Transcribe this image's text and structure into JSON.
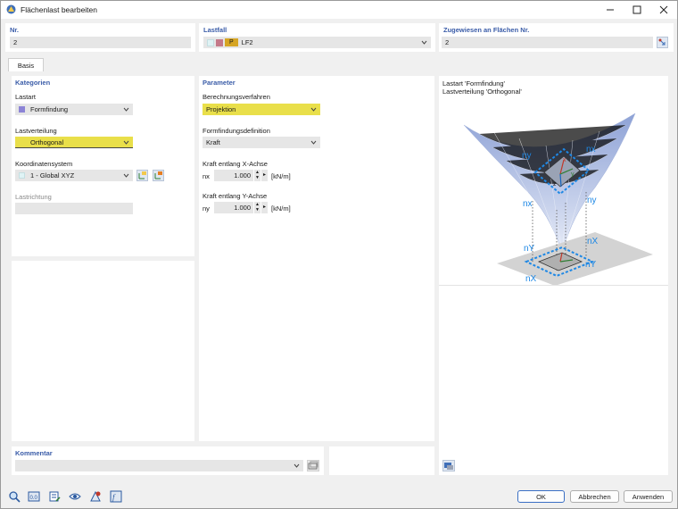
{
  "window": {
    "title": "Flächenlast bearbeiten"
  },
  "top": {
    "nr_label": "Nr.",
    "nr_value": "2",
    "lastfall_label": "Lastfall",
    "lastfall_tag": "P",
    "lastfall_value": "LF2",
    "zugewiesen_label": "Zugewiesen an Flächen Nr.",
    "zugewiesen_value": "2"
  },
  "tabs": [
    {
      "label": "Basis"
    }
  ],
  "kategorien": {
    "title": "Kategorien",
    "lastart_label": "Lastart",
    "lastart_value": "Formfindung",
    "lastverteilung_label": "Lastverteilung",
    "lastverteilung_value": "Orthogonal",
    "koordinatensystem_label": "Koordinatensystem",
    "koordinatensystem_value": "1 - Global XYZ",
    "lastrichtung_label": "Lastrichtung",
    "lastrichtung_value": ""
  },
  "parameter": {
    "title": "Parameter",
    "berechnungsverfahren_label": "Berechnungsverfahren",
    "berechnungsverfahren_value": "Projektion",
    "formfindungsdefinition_label": "Formfindungsdefinition",
    "formfindungsdefinition_value": "Kraft",
    "kraft_x_label": "Kraft entlang X-Achse",
    "kraft_x_symbol": "nx",
    "kraft_x_value": "1.000",
    "kraft_x_unit": "[kN/m]",
    "kraft_y_label": "Kraft entlang Y-Achse",
    "kraft_y_symbol": "ny",
    "kraft_y_value": "1.000",
    "kraft_y_unit": "[kN/m]"
  },
  "preview": {
    "line1": "Lastart 'Formfindung'",
    "line2": "Lastverteilung 'Orthogonal'",
    "labels": {
      "ny": "ny",
      "nx": "nx",
      "nY": "nY",
      "nX": "nX",
      "x": "x",
      "y": "y",
      "z": "z"
    }
  },
  "kommentar": {
    "label": "Kommentar",
    "value": ""
  },
  "footer": {
    "ok": "OK",
    "cancel": "Abbrechen",
    "apply": "Anwenden"
  },
  "colors": {
    "accent": "#3a5ca8",
    "highlight": "#e9df4a",
    "lastart_swatch": "#8c84d6",
    "lf_swatch1": "#c47a8a",
    "lf_swatch2": "#d6a524"
  }
}
